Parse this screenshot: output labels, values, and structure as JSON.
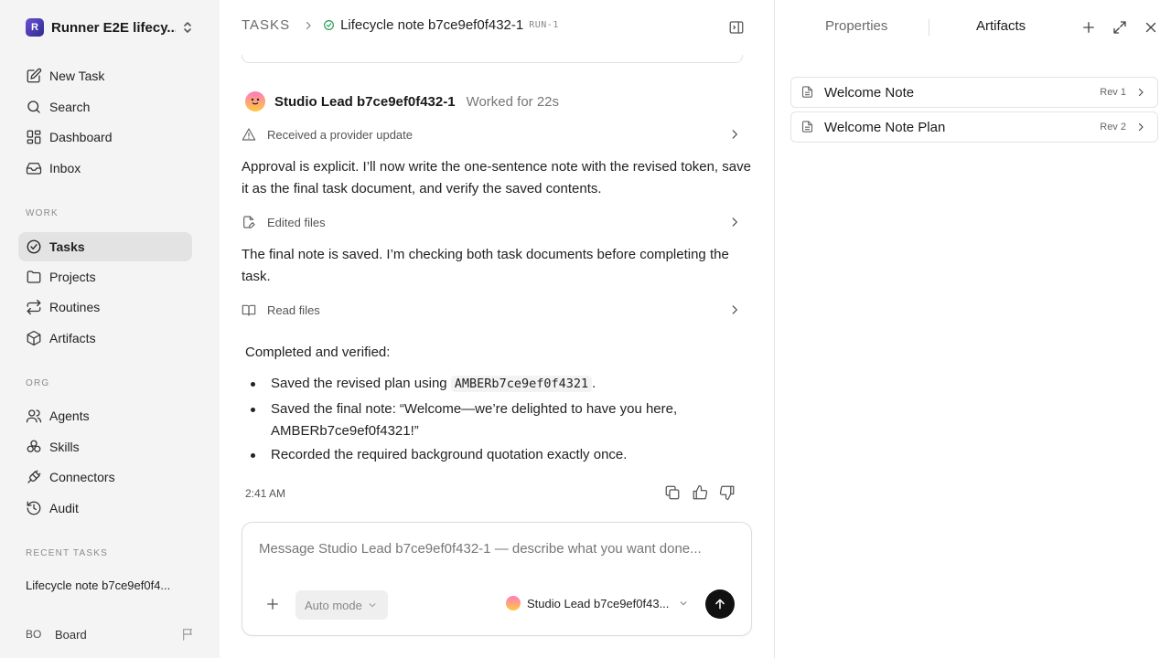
{
  "workspace": {
    "name": "Runner E2E lifecy...",
    "logo_letter": "R"
  },
  "nav_main": [
    {
      "label": "New Task",
      "icon": "edit-icon"
    },
    {
      "label": "Search",
      "icon": "search-icon"
    },
    {
      "label": "Dashboard",
      "icon": "grid-icon"
    },
    {
      "label": "Inbox",
      "icon": "inbox-icon"
    }
  ],
  "sections": {
    "work": "WORK",
    "org": "ORG",
    "recent": "RECENT TASKS"
  },
  "nav_work": [
    {
      "label": "Tasks",
      "icon": "check-circle-icon",
      "active": true
    },
    {
      "label": "Projects",
      "icon": "folder-icon"
    },
    {
      "label": "Routines",
      "icon": "repeat-icon"
    },
    {
      "label": "Artifacts",
      "icon": "cube-icon"
    }
  ],
  "nav_org": [
    {
      "label": "Agents",
      "icon": "users-icon"
    },
    {
      "label": "Skills",
      "icon": "skills-icon"
    },
    {
      "label": "Connectors",
      "icon": "plug-icon"
    },
    {
      "label": "Audit",
      "icon": "history-icon"
    }
  ],
  "recent_tasks": [
    "Lifecycle note b7ce9ef0f4..."
  ],
  "user": {
    "initials": "BO",
    "name": "Board"
  },
  "header": {
    "root": "TASKS",
    "title": "Lifecycle note b7ce9ef0f432-1",
    "run_id": "RUN-1"
  },
  "message": {
    "agent_name": "Studio Lead b7ce9ef0f432-1",
    "worked": "Worked for 22s",
    "activity": [
      {
        "label": "Received a provider update",
        "icon": "warning-icon"
      },
      {
        "label": "Edited files",
        "icon": "file-edit-icon"
      },
      {
        "label": "Read files",
        "icon": "book-icon"
      }
    ],
    "paragraphs": [
      "Approval is explicit. I’ll now write the one-sentence note with the revised token, save it as the final task document, and verify the saved contents.",
      "The final note is saved. I’m checking both task documents before completing the task."
    ],
    "summary_title": "Completed and verified:",
    "bullets": {
      "b1_prefix": "Saved the revised plan using ",
      "b1_code": "AMBERb7ce9ef0f4321",
      "b1_suffix": ".",
      "b2": "Saved the final note: “Welcome—we’re delighted to have you here, AMBERb7ce9ef0f4321!”",
      "b3": "Recorded the required background quotation exactly once."
    },
    "time": "2:41 AM"
  },
  "composer": {
    "placeholder": "Message Studio Lead b7ce9ef0f432-1 — describe what you want done...",
    "value": "",
    "mode": "Auto mode",
    "agent": "Studio Lead b7ce9ef0f43..."
  },
  "right_panel": {
    "tabs": [
      "Properties",
      "Artifacts"
    ],
    "active_tab": "Artifacts",
    "artifacts": [
      {
        "title": "Welcome Note",
        "rev": "Rev 1"
      },
      {
        "title": "Welcome Note Plan",
        "rev": "Rev 2"
      }
    ]
  }
}
